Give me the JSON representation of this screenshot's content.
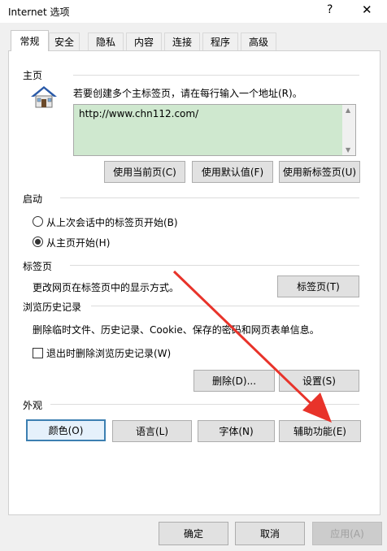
{
  "window": {
    "title": "Internet 选项",
    "help": "?",
    "close": "✕"
  },
  "tabs": [
    "常规",
    "安全",
    "隐私",
    "内容",
    "连接",
    "程序",
    "高级"
  ],
  "home": {
    "group": "主页",
    "instruction": "若要创建多个主标签页，请在每行输入一个地址(R)。",
    "url": "http://www.chn112.com/",
    "btn_current": "使用当前页(C)",
    "btn_default": "使用默认值(F)",
    "btn_newtab": "使用新标签页(U)"
  },
  "startup": {
    "group": "启动",
    "opt1": "从上次会话中的标签页开始(B)",
    "opt2": "从主页开始(H)",
    "selected": 2
  },
  "tabs_group": {
    "group": "标签页",
    "desc": "更改网页在标签页中的显示方式。",
    "btn": "标签页(T)"
  },
  "history": {
    "group": "浏览历史记录",
    "desc": "删除临时文件、历史记录、Cookie、保存的密码和网页表单信息。",
    "checkbox": "退出时删除浏览历史记录(W)",
    "btn_delete": "删除(D)...",
    "btn_settings": "设置(S)"
  },
  "appearance": {
    "group": "外观",
    "btn_colors": "颜色(O)",
    "btn_languages": "语言(L)",
    "btn_fonts": "字体(N)",
    "btn_access": "辅助功能(E)"
  },
  "footer": {
    "ok": "确定",
    "cancel": "取消",
    "apply": "应用(A)"
  },
  "colors": {
    "url_bg": "#cfe8cf",
    "default_btn_border": "#3c7fb1",
    "annotation_arrow": "#e8332a"
  },
  "icons": {
    "home": "house-icon",
    "arrow": "red-arrow-annotation"
  }
}
